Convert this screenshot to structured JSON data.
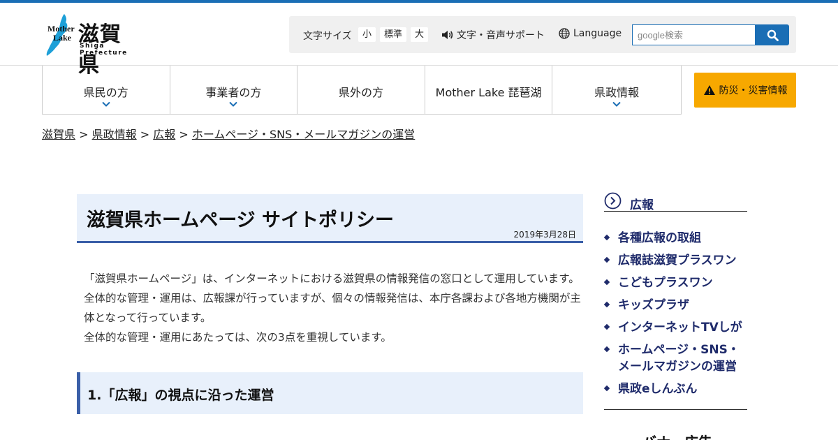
{
  "header": {
    "logo_mother": "Mother",
    "logo_lake": "Lake",
    "logo_name": "滋賀県",
    "logo_sub": "Shiga Prefecture",
    "text_size_label": "文字サイズ",
    "size_small": "小",
    "size_standard": "標準",
    "size_large": "大",
    "support_label": "文字・音声サポート",
    "language_label": "Language",
    "search_placeholder": "google検索"
  },
  "nav": {
    "items": [
      {
        "label": "県民の方",
        "has_dropdown": true
      },
      {
        "label": "事業者の方",
        "has_dropdown": true
      },
      {
        "label": "県外の方",
        "has_dropdown": false
      },
      {
        "label": "Mother Lake 琵琶湖",
        "has_dropdown": false
      },
      {
        "label": "県政情報",
        "has_dropdown": true
      }
    ],
    "disaster_label": "防災・災害情報"
  },
  "breadcrumb": {
    "items": [
      "滋賀県",
      "県政情報",
      "広報",
      "ホームページ・SNS・メールマガジンの運営"
    ],
    "separator": ">"
  },
  "main": {
    "title": "滋賀県ホームページ サイトポリシー",
    "date": "2019年3月28日",
    "paragraph1": "「滋賀県ホームページ」は、インターネットにおける滋賀県の情報発信の窓口として運用しています。全体的な管理・運用は、広報課が行っていますが、個々の情報発信は、本庁各課および各地方機関が主体となって行っています。",
    "paragraph2": "全体的な管理・運用にあたっては、次の3点を重視しています。",
    "section1": "1.「広報」の視点に沿った運営"
  },
  "sidebar": {
    "title": "広報",
    "items": [
      {
        "label": "各種広報の取組"
      },
      {
        "label": "広報誌滋賀プラスワン"
      },
      {
        "label": "こどもプラスワン"
      },
      {
        "label": "キッズプラザ"
      },
      {
        "label": "インターネットTVしが"
      },
      {
        "label": "ホームページ・SNS・メールマガジンの運営"
      },
      {
        "label": "県政eしんぶん"
      }
    ],
    "banner_title": "バナー広告"
  },
  "colors": {
    "brand_blue": "#1a6eb5",
    "navy": "#1f2b6b",
    "accent_bar": "#3a5fa8",
    "heading_bg": "#e8f0fb",
    "disaster_yellow": "#f7a800"
  }
}
